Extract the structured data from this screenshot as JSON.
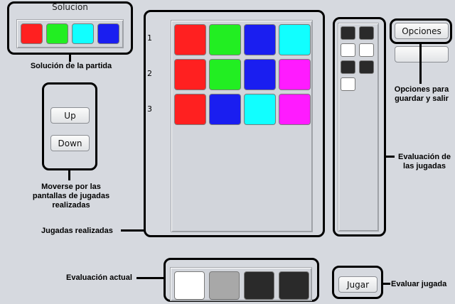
{
  "solution": {
    "title": "Solucion",
    "pegs": [
      "#ff2020",
      "#22ee22",
      "#11ffff",
      "#1a1ef0"
    ]
  },
  "guesses": {
    "row_numbers": [
      "1",
      "2",
      "3"
    ],
    "rows": [
      [
        "#ff2020",
        "#22ee22",
        "#1a1ef0",
        "#11ffff"
      ],
      [
        "#ff2020",
        "#22ee22",
        "#1a1ef0",
        "#ff1bff"
      ],
      [
        "#ff2020",
        "#1a1ef0",
        "#11ffff",
        "#ff1bff"
      ]
    ]
  },
  "feedback": {
    "rows": [
      [
        "black",
        "black",
        "white",
        "white"
      ],
      [
        "black",
        "black",
        "white",
        "none"
      ]
    ]
  },
  "nav": {
    "up_label": "Up",
    "down_label": "Down"
  },
  "options": {
    "options_label": "Opciones",
    "second_label": ""
  },
  "current_eval": {
    "pegs": [
      "white",
      "gray",
      "black",
      "black"
    ]
  },
  "play": {
    "label": "Jugar"
  },
  "annotations": {
    "solution": "Solución de la partida",
    "scroll": [
      "Moverse por las",
      "pantallas de jugadas",
      "realizadas"
    ],
    "guesses": "Jugadas realizadas",
    "options": [
      "Opciones para",
      "guardar y salir"
    ],
    "evaluation": [
      "Evaluación de",
      "las jugadas"
    ],
    "current": "Evaluación actual",
    "evaluate": "Evaluar jugada"
  }
}
